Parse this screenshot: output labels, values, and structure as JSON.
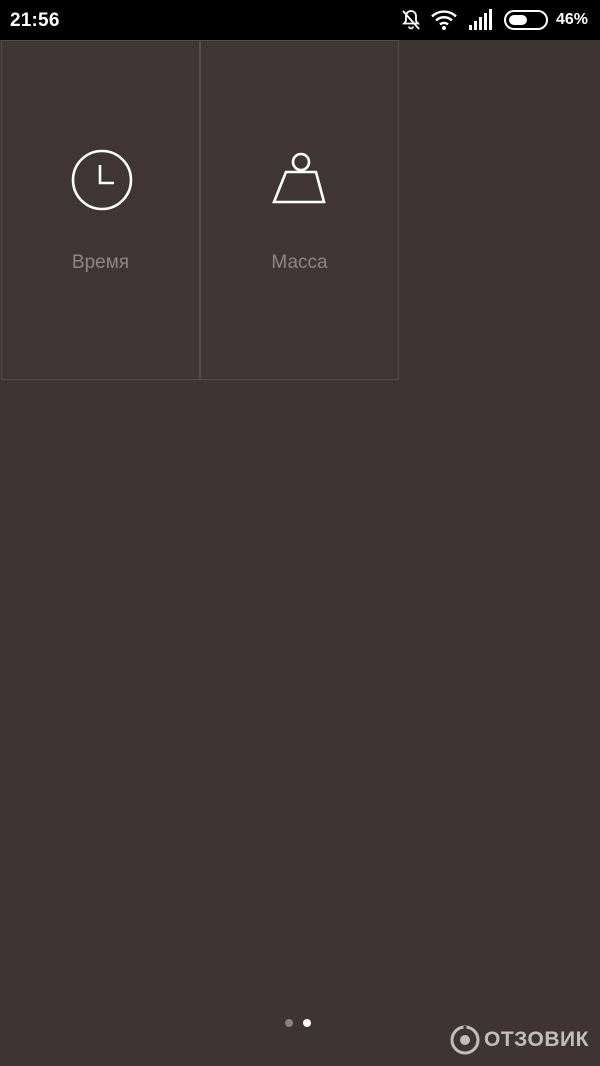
{
  "status_bar": {
    "time": "21:56",
    "battery_percent": "46%",
    "icons": [
      "bell-off-icon",
      "wifi-icon",
      "signal-icon",
      "battery-icon"
    ]
  },
  "tiles": [
    {
      "label": "Время",
      "icon": "clock-icon"
    },
    {
      "label": "Масса",
      "icon": "weight-icon"
    }
  ],
  "pager": {
    "pages": 2,
    "current": 2
  },
  "watermark": {
    "text": "ОТЗОВИК"
  },
  "colors": {
    "background": "#3e3433",
    "tile_border": "#574c4a",
    "label": "#8e8584",
    "status_bar": "#000000"
  }
}
